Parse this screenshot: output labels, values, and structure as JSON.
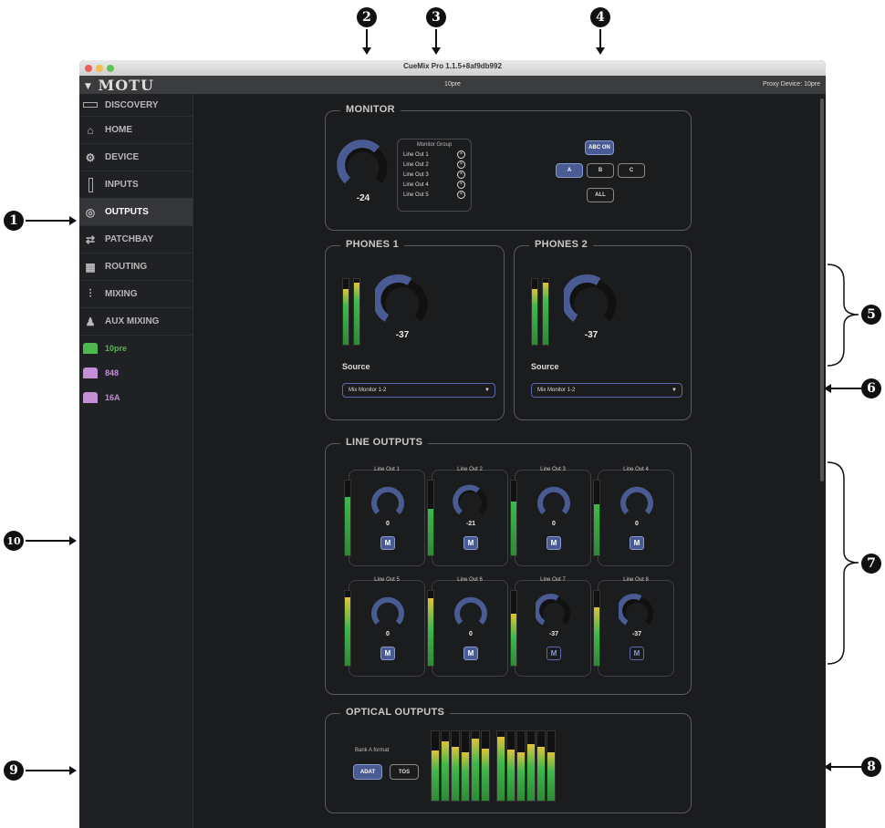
{
  "callouts": [
    "1",
    "2",
    "3",
    "4",
    "5",
    "6",
    "7",
    "8",
    "9",
    "10"
  ],
  "window": {
    "title": "CueMix Pro 1.1.5+8af9db992",
    "brand": "MOTU",
    "device_name": "10pre",
    "proxy_device": "Proxy Device: 10pre"
  },
  "sidebar": {
    "items": [
      {
        "label": "DISCOVERY",
        "icon": "discovery-icon"
      },
      {
        "label": "HOME",
        "icon": "home-icon"
      },
      {
        "label": "DEVICE",
        "icon": "gear-icon"
      },
      {
        "label": "INPUTS",
        "icon": "inputs-icon"
      },
      {
        "label": "OUTPUTS",
        "icon": "outputs-icon"
      },
      {
        "label": "PATCHBAY",
        "icon": "patchbay-icon"
      },
      {
        "label": "ROUTING",
        "icon": "routing-icon"
      },
      {
        "label": "MIXING",
        "icon": "mixing-icon"
      },
      {
        "label": "AUX MIXING",
        "icon": "aux-mixing-icon"
      }
    ],
    "devices": [
      {
        "label": "10pre",
        "color": "#4fb84f"
      },
      {
        "label": "848",
        "color": "#c48fd6"
      },
      {
        "label": "16A",
        "color": "#c48fd6"
      }
    ]
  },
  "monitor": {
    "title": "MONITOR",
    "value": "-24",
    "group_title": "Monitor Group",
    "group_items": [
      "Line Out 1",
      "Line Out 2",
      "Line Out 3",
      "Line Out 4",
      "Line Out 5"
    ],
    "abc_label": "ABC ON",
    "a_label": "A",
    "b_label": "B",
    "c_label": "C",
    "all_label": "ALL"
  },
  "phones": [
    {
      "title": "PHONES 1",
      "value": "-37",
      "source_label": "Source",
      "source": "Mix Monitor 1-2"
    },
    {
      "title": "PHONES 2",
      "value": "-37",
      "source_label": "Source",
      "source": "Mix Monitor 1-2"
    }
  ],
  "line_outputs": {
    "title": "LINE OUTPUTS",
    "channels": [
      {
        "name": "Line Out 1",
        "value": "0",
        "mute": "M",
        "level": 0.78
      },
      {
        "name": "Line Out 2",
        "value": "-21",
        "mute": "M",
        "level": 0.62
      },
      {
        "name": "Line Out 3",
        "value": "0",
        "mute": "M",
        "level": 0.72
      },
      {
        "name": "Line Out 4",
        "value": "0",
        "mute": "M",
        "level": 0.68
      },
      {
        "name": "Line Out 5",
        "value": "0",
        "mute": "M",
        "level": 0.92
      },
      {
        "name": "Line Out 6",
        "value": "0",
        "mute": "M",
        "level": 0.9
      },
      {
        "name": "Line Out 7",
        "value": "-37",
        "mute": "M",
        "level": 0.7
      },
      {
        "name": "Line Out 8",
        "value": "-37",
        "mute": "M",
        "level": 0.78
      }
    ]
  },
  "optical": {
    "title": "OPTICAL OUTPUTS",
    "bank_label": "Bank A format",
    "adat_label": "ADAT",
    "tos_label": "TOS",
    "levels": [
      0.72,
      0.85,
      0.78,
      0.7,
      0.9,
      0.75,
      0.92,
      0.74,
      0.7,
      0.82,
      0.77,
      0.7
    ]
  },
  "colors": {
    "accent": "#4a5a92",
    "meter_green": "#3fb84a",
    "meter_yellow": "#e0c23a"
  }
}
